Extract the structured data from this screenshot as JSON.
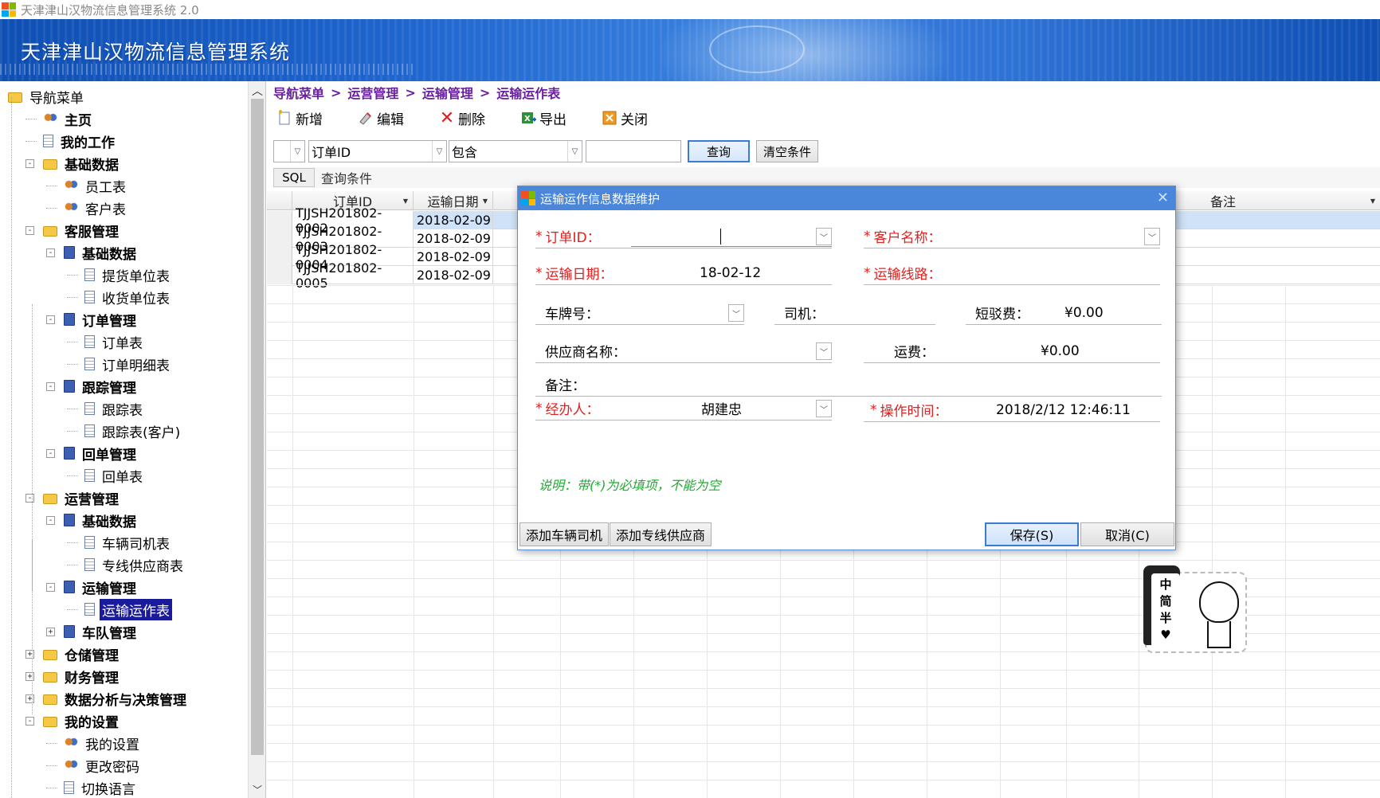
{
  "window": {
    "title": "天津津山汉物流信息管理系统 2.0",
    "app_icon": "windows-logo-icon",
    "icon_colors": [
      "#f25022",
      "#7fba00",
      "#00a4ef",
      "#ffb900"
    ]
  },
  "banner": {
    "title": "天津津山汉物流信息管理系统"
  },
  "nav": {
    "items": [
      {
        "label": "导航菜单",
        "icon": "folder-open-icon"
      },
      {
        "label": "主页",
        "icon": "home-icon"
      },
      {
        "label": "我的工作",
        "icon": "notepad-icon"
      },
      {
        "label": "基础数据",
        "icon": "folder-open-icon"
      },
      {
        "label": "员工表",
        "icon": "users-icon"
      },
      {
        "label": "客户表",
        "icon": "users-icon"
      },
      {
        "label": "客服管理",
        "icon": "folder-open-icon"
      },
      {
        "label": "基础数据",
        "icon": "book-icon"
      },
      {
        "label": "提货单位表",
        "icon": "page-icon"
      },
      {
        "label": "收货单位表",
        "icon": "page-icon"
      },
      {
        "label": "订单管理",
        "icon": "book-icon"
      },
      {
        "label": "订单表",
        "icon": "page-icon"
      },
      {
        "label": "订单明细表",
        "icon": "page-icon"
      },
      {
        "label": "跟踪管理",
        "icon": "book-icon"
      },
      {
        "label": "跟踪表",
        "icon": "page-icon"
      },
      {
        "label": "跟踪表(客户)",
        "icon": "page-icon"
      },
      {
        "label": "回单管理",
        "icon": "book-icon"
      },
      {
        "label": "回单表",
        "icon": "page-icon"
      },
      {
        "label": "运营管理",
        "icon": "folder-open-icon"
      },
      {
        "label": "基础数据",
        "icon": "book-icon"
      },
      {
        "label": "车辆司机表",
        "icon": "page-icon"
      },
      {
        "label": "专线供应商表",
        "icon": "page-icon"
      },
      {
        "label": "运输管理",
        "icon": "book-icon"
      },
      {
        "label": "运输运作表",
        "icon": "page-icon"
      },
      {
        "label": "车队管理",
        "icon": "book-icon"
      },
      {
        "label": "仓储管理",
        "icon": "folder-icon"
      },
      {
        "label": "财务管理",
        "icon": "folder-icon"
      },
      {
        "label": "数据分析与决策管理",
        "icon": "folder-icon"
      },
      {
        "label": "我的设置",
        "icon": "folder-open-icon"
      },
      {
        "label": "我的设置",
        "icon": "settings-icon"
      },
      {
        "label": "更改密码",
        "icon": "user-key-icon"
      },
      {
        "label": "切换语言",
        "icon": "language-icon"
      }
    ],
    "selected_label": "运输运作表"
  },
  "breadcrumb": [
    "导航菜单",
    "运营管理",
    "运输管理",
    "运输运作表"
  ],
  "breadcrumb_sep": ">",
  "toolbar": {
    "add": "新增",
    "edit": "编辑",
    "delete": "删除",
    "export": "导出",
    "close": "关闭"
  },
  "filter": {
    "logic_value": "",
    "field_value": "订单ID",
    "operator_value": "包含",
    "keyword_value": "",
    "query_label": "查询",
    "clear_label": "清空条件"
  },
  "sqlbar": {
    "sql_label": "SQL",
    "condition_label": "查询条件"
  },
  "grid": {
    "columns": [
      "订单ID",
      "运输日期",
      "备注"
    ],
    "rows": [
      {
        "order_id": "TJJSH201802-0002",
        "date": "2018-02-09"
      },
      {
        "order_id": "TJJSH201802-0003",
        "date": "2018-02-09"
      },
      {
        "order_id": "TJJSH201802-0004",
        "date": "2018-02-09"
      },
      {
        "order_id": "TJJSH201802-0005",
        "date": "2018-02-09"
      }
    ]
  },
  "dialog": {
    "title": "运输运作信息数据维护",
    "req_mark": "*",
    "fields": {
      "order_id": {
        "label": "订单ID：",
        "value": ""
      },
      "customer": {
        "label": "客户名称：",
        "value": ""
      },
      "date": {
        "label": "运输日期：",
        "value": "18-02-12"
      },
      "route": {
        "label": "运输线路：",
        "value": ""
      },
      "plate": {
        "label": "车牌号：",
        "value": ""
      },
      "driver": {
        "label": "司机：",
        "value": ""
      },
      "short_fee": {
        "label": "短驳费：",
        "value": "¥0.00"
      },
      "supplier": {
        "label": "供应商名称：",
        "value": ""
      },
      "freight": {
        "label": "运费：",
        "value": "¥0.00"
      },
      "remark": {
        "label": "备注：",
        "value": ""
      },
      "handler": {
        "label": "经办人：",
        "value": "胡建忠"
      },
      "op_time": {
        "label": "操作时间：",
        "value": "2018/2/12 12:46:11"
      }
    },
    "note": "说明：带(*)为必填项，不能为空",
    "buttons": {
      "add_vehicle": "添加车辆司机",
      "add_supplier": "添加专线供应商",
      "save": "保存(S)",
      "cancel": "取消(C)"
    }
  },
  "sticker": {
    "chars": [
      "中",
      "简",
      "半"
    ]
  }
}
